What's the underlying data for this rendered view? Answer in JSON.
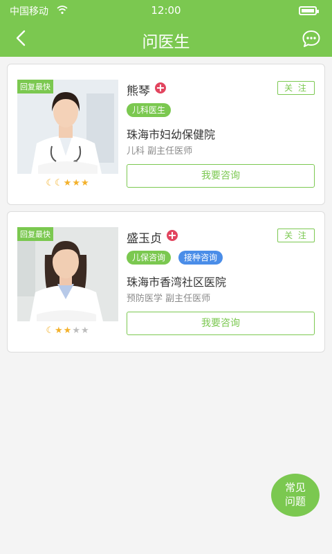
{
  "status_bar": {
    "carrier": "中国移动",
    "time": "12:00"
  },
  "nav": {
    "title": "问医生"
  },
  "doctors": [
    {
      "reply_badge": "回复最快",
      "name": "熊琴",
      "follow_label": "关 注",
      "tags": [
        "儿科医生"
      ],
      "hospital": "珠海市妇幼保健院",
      "dept": "儿科 副主任医师",
      "consult_label": "我要咨询",
      "rating": {
        "moons": 2,
        "stars_on": 3,
        "stars_off": 0
      }
    },
    {
      "reply_badge": "回复最快",
      "name": "盛玉贞",
      "follow_label": "关 注",
      "tags": [
        "儿保咨询",
        "接种咨询"
      ],
      "hospital": "珠海市香湾社区医院",
      "dept": "预防医学 副主任医师",
      "consult_label": "我要咨询",
      "rating": {
        "moons": 1,
        "stars_on": 2,
        "stars_off": 2
      }
    }
  ],
  "faq": {
    "line1": "常见",
    "line2": "问题"
  },
  "colors": {
    "accent": "#7bc850",
    "tag_blue": "#4a8de8",
    "badge_red": "#e2455f",
    "star": "#f3b12b"
  }
}
